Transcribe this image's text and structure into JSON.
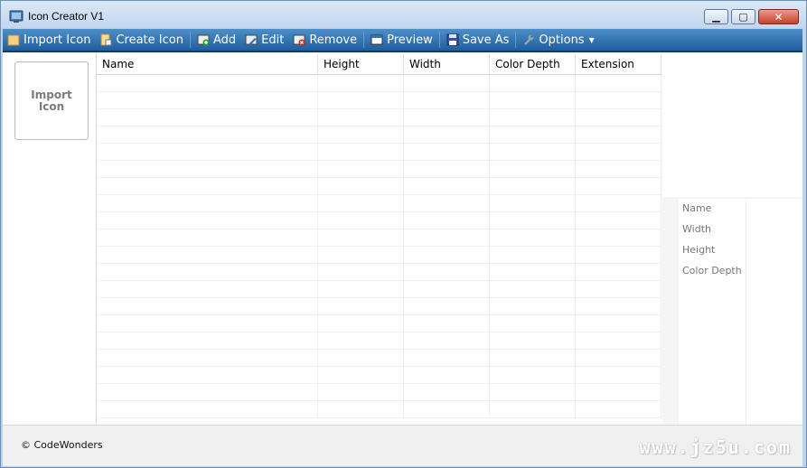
{
  "window": {
    "title": "Icon Creator V1"
  },
  "toolbar": {
    "items": [
      {
        "label": "Import Icon"
      },
      {
        "label": "Create Icon"
      },
      {
        "label": "Add"
      },
      {
        "label": "Edit"
      },
      {
        "label": "Remove"
      },
      {
        "label": "Preview"
      },
      {
        "label": "Save As"
      },
      {
        "label": "Options"
      }
    ]
  },
  "import_panel": {
    "button_label": "Import\nIcon"
  },
  "grid": {
    "columns": [
      "Name",
      "Height",
      "Width",
      "Color Depth",
      "Extension"
    ]
  },
  "properties": {
    "labels": [
      "Name",
      "Width",
      "Height",
      "Color Depth"
    ]
  },
  "status": {
    "copyright": "© CodeWonders",
    "watermark": "www.jz5u.com"
  },
  "colors": {
    "toolbar": "#2a6cb0",
    "title_bar": "#c8daf0",
    "close": "#c7402b"
  }
}
